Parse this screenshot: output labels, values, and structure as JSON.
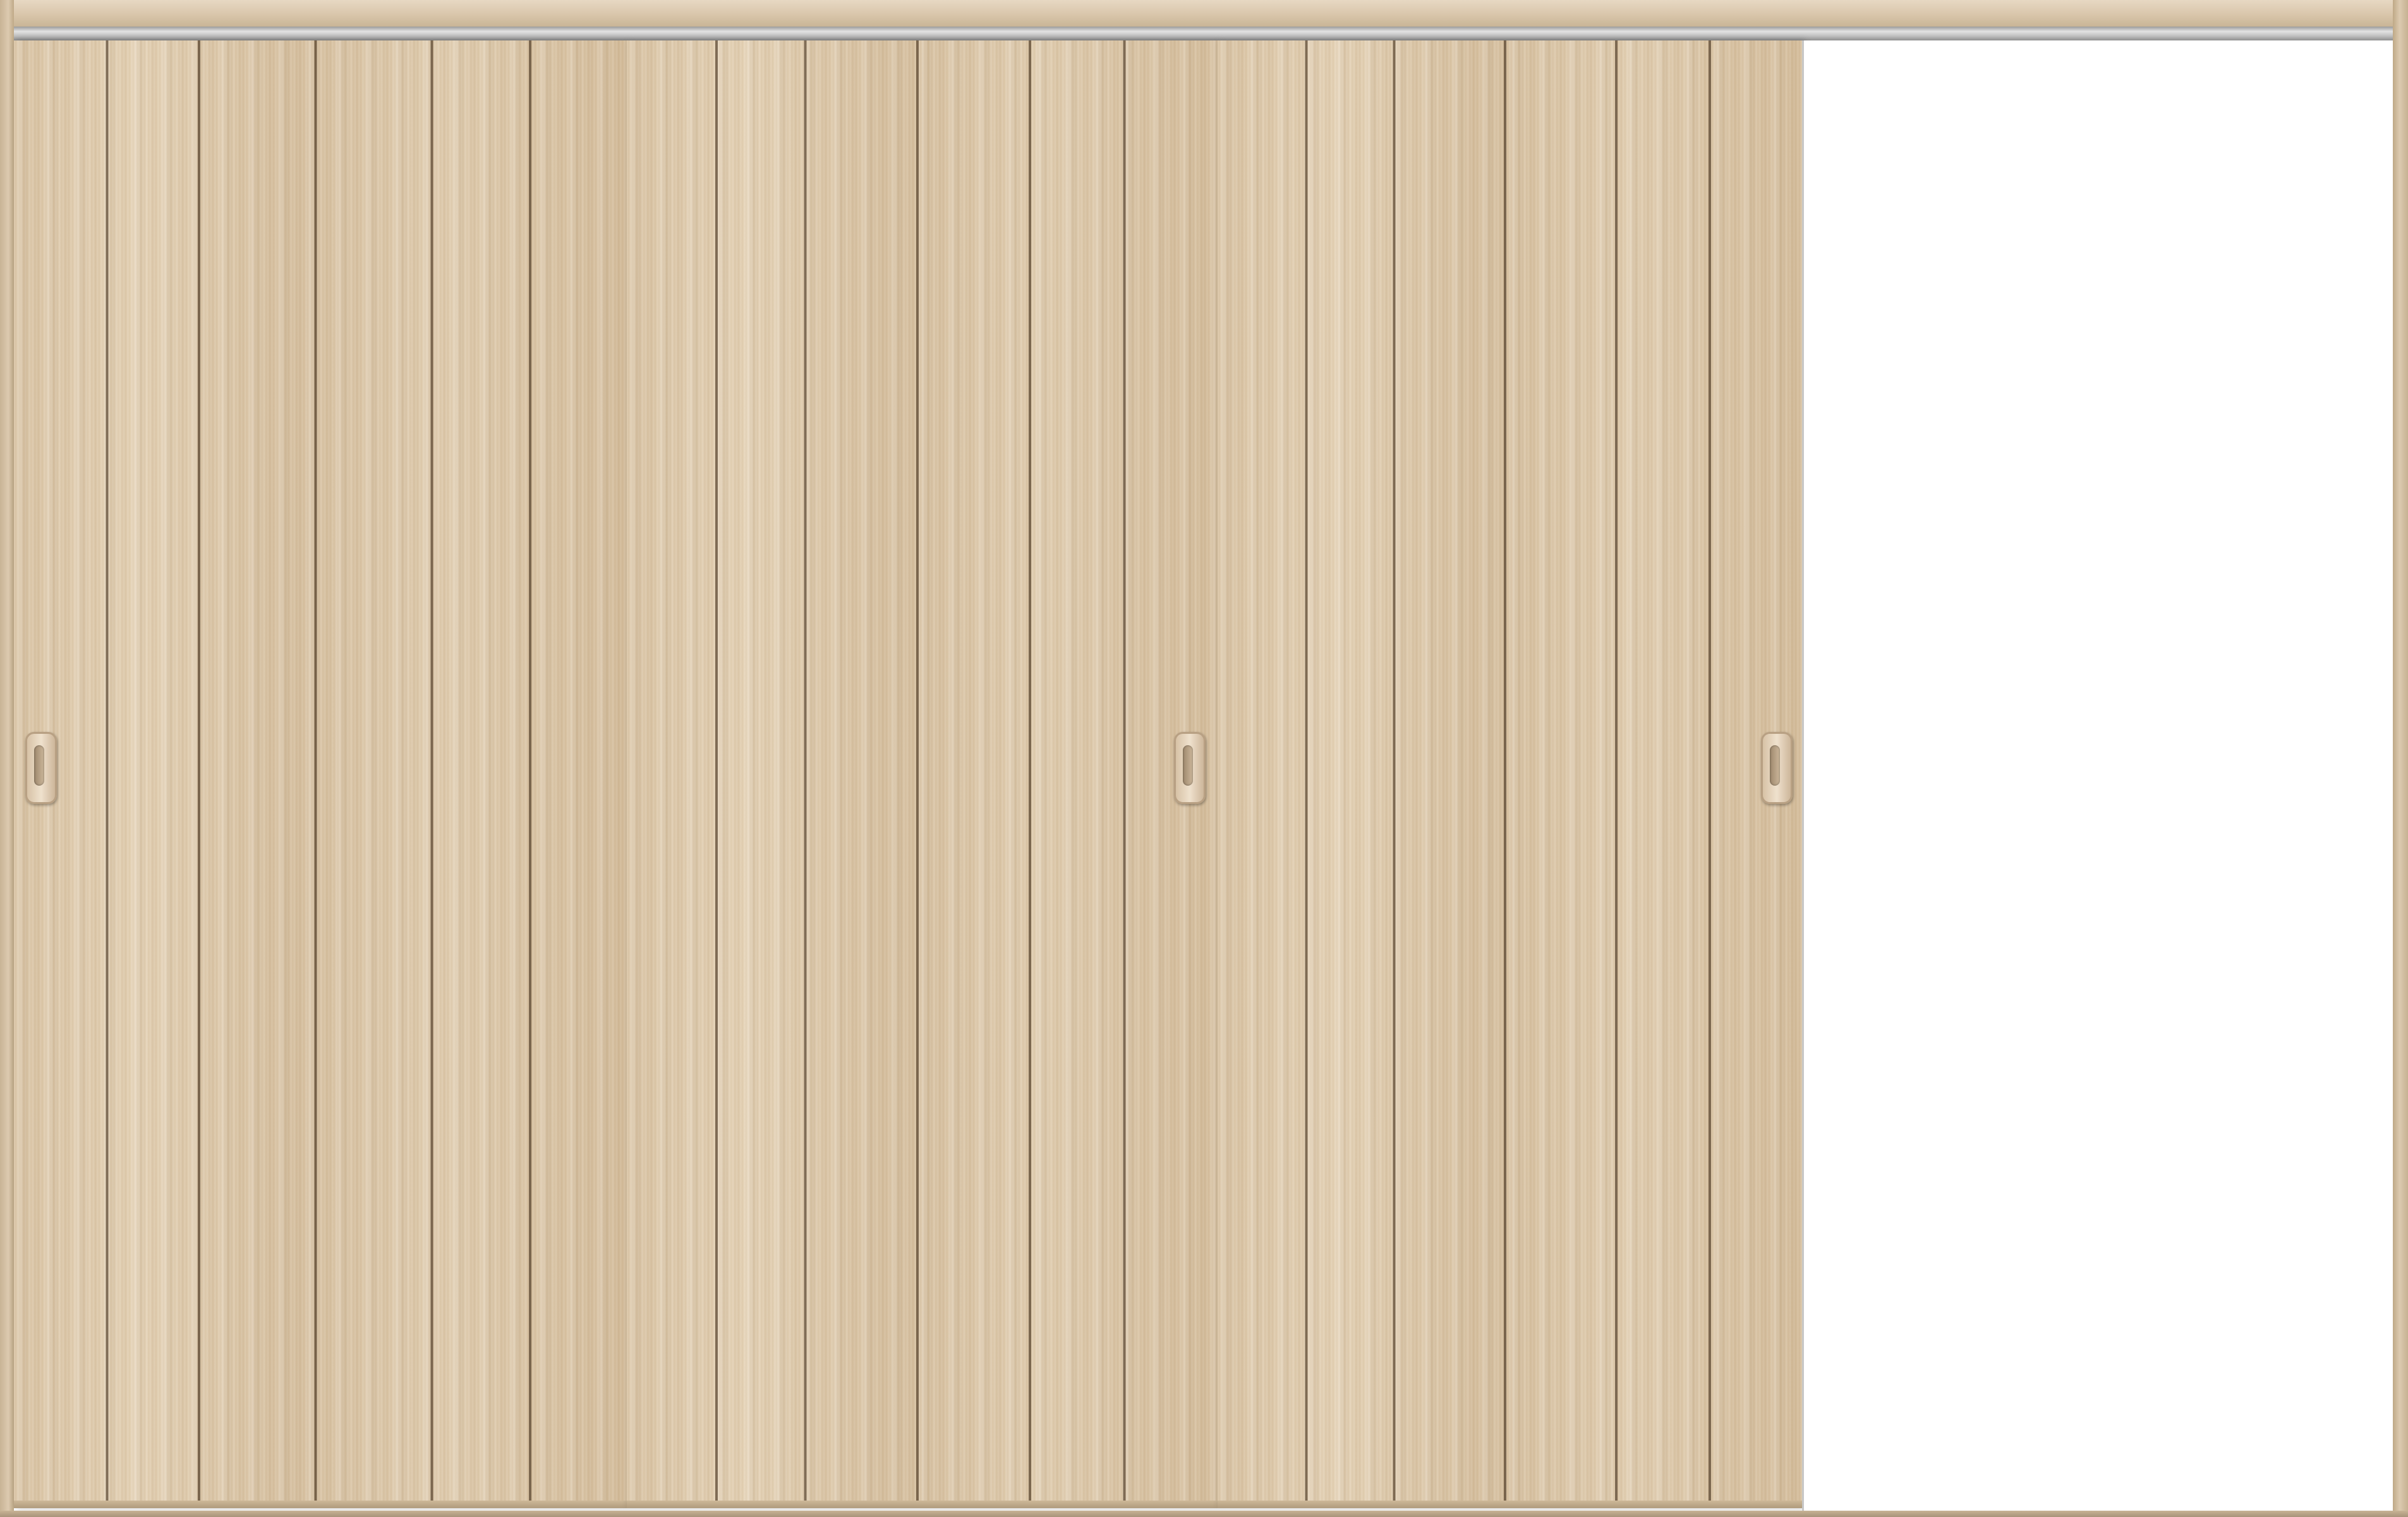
{
  "scene": {
    "panel_count": 3,
    "finish_color": "#dcc7a8",
    "frame_color": "#d9c6ab",
    "track_color": "#bdbdbd",
    "opening_color": "#ffffff",
    "handle_icon": "recessed-pull-handle"
  }
}
